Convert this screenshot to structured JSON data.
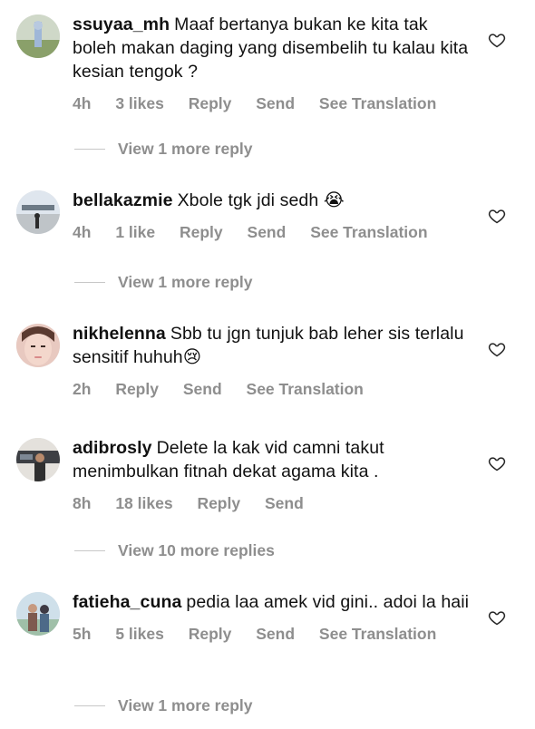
{
  "comments": [
    {
      "username": "ssuyaa_mh",
      "text": "Maaf bertanya bukan ke kita tak boleh makan daging yang disembelih tu kalau kita kesian tengok ?",
      "time": "4h",
      "likes": "3 likes",
      "reply": "Reply",
      "send": "Send",
      "translate": "See Translation",
      "view_more": "View 1 more reply"
    },
    {
      "username": "bellakazmie",
      "text": "Xbole tgk jdi sedh 😭",
      "time": "4h",
      "likes": "1 like",
      "reply": "Reply",
      "send": "Send",
      "translate": "See Translation",
      "view_more": "View 1 more reply"
    },
    {
      "username": "nikhelenna",
      "text": "Sbb tu jgn tunjuk bab leher sis terlalu sensitif huhuh😢",
      "time": "2h",
      "reply": "Reply",
      "send": "Send",
      "translate": "See Translation"
    },
    {
      "username": "adibrosly",
      "text": "Delete la kak vid camni takut menimbulkan fitnah dekat agama kita .",
      "time": "8h",
      "likes": "18 likes",
      "reply": "Reply",
      "send": "Send",
      "view_more": "View 10 more replies"
    },
    {
      "username": "fatieha_cuna",
      "text": "pedia laa amek vid gini.. adoi la haii",
      "time": "5h",
      "likes": "5 likes",
      "reply": "Reply",
      "send": "Send",
      "translate": "See Translation",
      "view_more": "View 1 more reply"
    }
  ],
  "icons": {
    "like": "heart-outline-icon"
  },
  "colors": {
    "text": "#111111",
    "secondary": "#8e8e8e",
    "divider": "#c7c7c7"
  }
}
